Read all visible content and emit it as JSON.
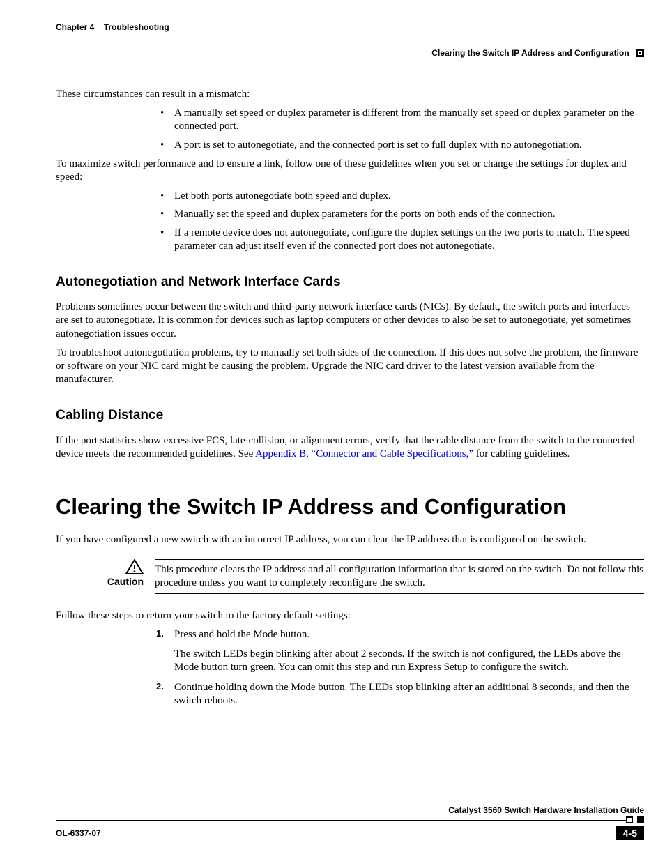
{
  "header": {
    "chapter_label": "Chapter 4",
    "chapter_title": "Troubleshooting",
    "section_title": "Clearing the Switch IP Address and Configuration"
  },
  "intro": {
    "lead": "These circumstances can result in a mismatch:",
    "bullets1": [
      "A manually set speed or duplex parameter is different from the manually set speed or duplex parameter on the connected port.",
      "A port is set to autonegotiate, and the connected port is set to full duplex with no autonegotiation."
    ],
    "mid": "To maximize switch performance and to ensure a link, follow one of these guidelines when you set or change the settings for duplex and speed:",
    "bullets2": [
      "Let both ports autonegotiate both speed and duplex.",
      "Manually set the speed and duplex parameters for the ports on both ends of the connection.",
      "If a remote device does not autonegotiate, configure the duplex settings on the two ports to match. The speed parameter can adjust itself even if the connected port does not autonegotiate."
    ]
  },
  "sec1": {
    "head": "Autonegotiation and Network Interface Cards",
    "p1": "Problems sometimes occur between the switch and third-party network interface cards (NICs). By default, the switch ports and interfaces are set to autonegotiate. It is common for devices such as laptop computers or other devices to also be set to autonegotiate, yet sometimes autonegotiation issues occur.",
    "p2": "To troubleshoot autonegotiation problems, try to manually set both sides of the connection. If this does not solve the problem, the firmware or software on your NIC card might be causing the problem. Upgrade the NIC card driver to the latest version available from the manufacturer."
  },
  "sec2": {
    "head": "Cabling Distance",
    "p_pre": "If the port statistics show excessive FCS, late-collision, or alignment errors, verify that the cable distance from the switch to the connected device meets the recommended guidelines. See ",
    "link": "Appendix B, “Connector and Cable Specifications,”",
    "p_post": " for cabling guidelines."
  },
  "main": {
    "head": "Clearing the Switch IP Address and Configuration",
    "p1": "If you have configured a new switch with an incorrect IP address, you can clear the IP address that is configured on the switch.",
    "caution_label": "Caution",
    "caution_text": "This procedure clears the IP address and all configuration information that is stored on the switch. Do not follow this procedure unless you want to completely reconfigure the switch.",
    "p2": "Follow these steps to return your switch to the factory default settings:",
    "steps": [
      {
        "t": "Press and hold the Mode button.",
        "sub": "The switch LEDs begin blinking after about 2 seconds. If the switch is not configured, the LEDs above the Mode button turn green. You can omit this step and run Express Setup to configure the switch."
      },
      {
        "t": "Continue holding down the Mode button. The LEDs stop blinking after an additional 8 seconds, and then the switch reboots.",
        "sub": ""
      }
    ]
  },
  "footer": {
    "guide": "Catalyst 3560 Switch Hardware Installation Guide",
    "docnum": "OL-6337-07",
    "pagenum": "4-5"
  }
}
